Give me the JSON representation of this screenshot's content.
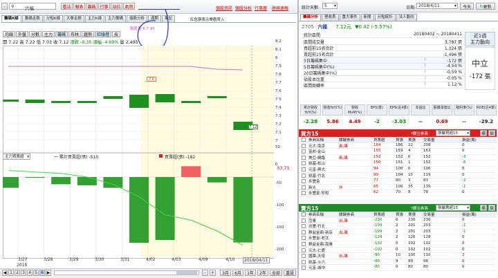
{
  "toolbar": {
    "nav_buttons": [
      "-",
      "◄",
      "►",
      "+"
    ],
    "stock_code": "六福",
    "function_buttons": [
      "看法",
      "報表",
      "籌碼",
      "行事",
      "站拉",
      "氣哥"
    ],
    "links": [
      "個股資訊",
      "個股分析",
      "行事曆",
      "財務速報"
    ]
  },
  "left_tabs": [
    "籌碼K線",
    "籌碼走勢",
    "分點K線",
    "大單走勢",
    "主力K線",
    "主力籌碼",
    "個股分析",
    "週期",
    "筆記"
  ],
  "left_subtitle": "紅色張表示樂觀買入",
  "chart_toolbar": [
    "均線",
    "外盤",
    "分數",
    "主力",
    "籌碼",
    "布林",
    "趨勢",
    "紅綠燈",
    "技"
  ],
  "ohlc": {
    "open_label": "開",
    "open": "7.22",
    "high_label": "高",
    "high": "7.22",
    "low_label": "低",
    "low": "7.03",
    "close_label": "收",
    "close": "7.12",
    "change_label": "漲跌",
    "change": "-0.35",
    "pct_label": "漲幅",
    "pct": "-4.69%",
    "vol_label": "量",
    "vol": "2,495"
  },
  "ma_label": "聯盈量 6.7.95",
  "ma_dot_value": "7.6",
  "price_tag": "7.12",
  "indicator_panel": {
    "select": "主力買賣超",
    "legend1": "一 累計買賣超(張) -510",
    "legend2": "買賣超(張) -182",
    "value_marker": "33.71"
  },
  "y_axis_price": [
    "8.2",
    "8.1",
    "8",
    "7.9",
    "7.8",
    "7.7",
    "7.6",
    "7.5",
    "7.4",
    "7.3",
    "7.2",
    "7.1",
    "7"
  ],
  "y_axis_vol": [
    "50",
    "0",
    "-50",
    "-100",
    "-150",
    "-200"
  ],
  "x_axis": [
    "3/27",
    "3/28",
    "3/29",
    "3/30",
    "3/31",
    "4/02",
    "4/03",
    "4/09",
    "4/10"
  ],
  "x_axis_year": "2018",
  "x_axis_current": "2018/04/11",
  "bottom_bar": {
    "page_buttons": [
      "1",
      "2",
      "3",
      "4",
      "5",
      "6"
    ],
    "period_buttons": [
      "3月",
      "6月",
      "1年",
      "2年",
      "全部",
      "重設"
    ]
  },
  "right_header": {
    "filter_label": "統計天數:",
    "filter_value": "5",
    "date_label": "日期:",
    "date_value": "2018/4/11",
    "today": "今天",
    "refresh": "更新"
  },
  "right_tabs": [
    "籌碼分析",
    "營收表",
    "重大事件",
    "新聞",
    "分點統計",
    "法人動向"
  ],
  "stock_info": {
    "code": "2705",
    "name": "六福",
    "price": "7.12元",
    "change": "▼0.42 (-5.57%)",
    "period_label": "統計區間",
    "period": "20180402 ~ 20180411",
    "rank": "近1週",
    "power_label": "主力動向"
  },
  "summary_rows": [
    {
      "label": "區間成交量",
      "value": "3,787 張"
    },
    {
      "label": "買超前15名合計",
      "value": "1,324 張"
    },
    {
      "label": "賣超前15名合計",
      "value": "-1,496 張"
    },
    {
      "label": "5日籌碼集中",
      "value": "-172 張"
    },
    {
      "label": "5日籌碼集中(%)",
      "value": "-4.54 %"
    },
    {
      "label": "20日籌碼集中(%)",
      "value": "-0.59 %"
    },
    {
      "label": "佔股本比重",
      "value": "-0.05 %"
    },
    {
      "label": "區間周轉率",
      "value": "1.12 %"
    }
  ],
  "trend": {
    "label": "中立",
    "value": "-172 張"
  },
  "metrics": [
    {
      "head": "累計營收YoY(%)",
      "value": "-2.28",
      "color": "#008a00"
    },
    {
      "head": "營收YoY(%)",
      "value": "5.86",
      "color": "#d00000"
    },
    {
      "head": "營收MoM(%)",
      "value": "4.49",
      "color": "#d00000"
    },
    {
      "head": "EPS(季)",
      "value": "-2",
      "color": "#008a00"
    },
    {
      "head": "EPS(近4季)",
      "value": "-3.03",
      "color": "#008a00"
    },
    {
      "head": "本益比",
      "value": "--",
      "color": "#222"
    },
    {
      "head": "股價淨值比",
      "value": "0.69",
      "color": "#d00000"
    },
    {
      "head": "殖利率(%)",
      "value": "--",
      "color": "#222"
    },
    {
      "head": "ROE(近4季)",
      "value": "-29.2",
      "color": "#222"
    }
  ],
  "buy_table": {
    "title": "買方15",
    "dropdown_label": "?關注券商",
    "dropdown_value": "張屬買超15",
    "btn1": "欄",
    "btn2": "鎖",
    "columns": [
      "券商名稱",
      "關鍵券商",
      "買賣超",
      "買張",
      "賣張",
      "交易量",
      "損益(萬)"
    ],
    "rows": [
      [
        "元大-南京",
        "風,飆",
        "164",
        "186",
        "22",
        "208",
        "0"
      ],
      [
        "富邦-金山",
        "",
        "155",
        "159",
        "4",
        "163",
        "0"
      ],
      [
        "美亞-網路",
        "風,飆",
        "152",
        "152",
        "0",
        "152",
        "-3"
      ],
      [
        "凱基-松山",
        "",
        "150",
        "151",
        "1",
        "152",
        "-6"
      ],
      [
        "元富-興大",
        "",
        "94",
        "100",
        "6",
        "106",
        "0"
      ],
      [
        "凱基-竹北",
        "",
        "89",
        "104",
        "15",
        "119",
        "0"
      ],
      [
        "永豐金",
        "",
        "77",
        "80",
        "3",
        "83",
        "-2"
      ],
      [
        "新光",
        "作",
        "65",
        "100",
        "35",
        "135",
        "-1"
      ],
      [
        "永豐金-安和",
        "",
        "62",
        "70",
        "8",
        "78",
        "0"
      ]
    ]
  },
  "sell_table": {
    "title": "賣方15",
    "dropdown_label": "?關注券商",
    "dropdown_value": "張屬賣超15",
    "btn1": "欄",
    "btn2": "鎖",
    "columns": [
      "券商名稱",
      "關鍵券商",
      "買賣超",
      "買張",
      "賣張",
      "交易量",
      "損益(萬)"
    ],
    "rows": [
      [
        "亞東",
        "出,飆",
        "-230",
        "0",
        "230",
        "230",
        "0"
      ],
      [
        "兆豐-竹北",
        "",
        "-199",
        "2",
        "201",
        "203",
        "-1"
      ],
      [
        "群益金鼎-新店",
        "出,飆",
        "-199",
        "2",
        "201",
        "203",
        "-1"
      ],
      [
        "永豐金-老北",
        "",
        "-124",
        "2",
        "126",
        "128",
        "0"
      ],
      [
        "群益金鼎-南臺",
        "",
        "-102",
        "0",
        "102",
        "102",
        "0"
      ],
      [
        "元大-仁愛",
        "",
        "-102",
        "0",
        "102",
        "102",
        "0"
      ],
      [
        "國票-天母",
        "出,飆",
        "-90",
        "10",
        "100",
        "110",
        "2"
      ],
      [
        "凱基-斗六",
        "",
        "-80",
        "9",
        "89",
        "98",
        "0"
      ],
      [
        "元富-城中",
        "",
        "-80",
        "0",
        "80",
        "80",
        "0"
      ]
    ]
  },
  "chart_data": {
    "type": "bar",
    "dates": [
      "3/27",
      "3/28",
      "3/29",
      "3/30",
      "3/31",
      "4/02",
      "4/03",
      "4/09",
      "4/10",
      "4/11"
    ],
    "candles": [
      {
        "open": 7.49,
        "close": 7.48
      },
      {
        "open": 7.49,
        "close": 7.45
      },
      {
        "open": 7.46,
        "close": 7.48
      },
      {
        "open": 7.48,
        "close": 7.46
      },
      {
        "open": 7.5,
        "close": 7.54
      },
      {
        "open": 7.55,
        "close": 7.39
      },
      {
        "open": 7.56,
        "close": 7.46
      },
      {
        "open": 7.45,
        "close": 7.48
      },
      {
        "open": 7.54,
        "close": 7.54
      },
      {
        "open": 7.22,
        "close": 7.12
      }
    ],
    "ma_line": [
      7.9,
      7.9,
      7.9,
      7.9,
      7.9,
      7.9,
      7.9,
      7.9,
      7.87,
      7.86
    ],
    "net_buy": [
      -30,
      -2,
      -20,
      -23,
      -30,
      -183,
      -175,
      30,
      -15,
      -182
    ],
    "cumulative": [
      18,
      14,
      10,
      0,
      -20,
      -55,
      -105,
      -120,
      -150,
      -190
    ],
    "price_ylim": [
      7.0,
      8.2
    ],
    "volume_ylim": [
      -200,
      50
    ]
  }
}
